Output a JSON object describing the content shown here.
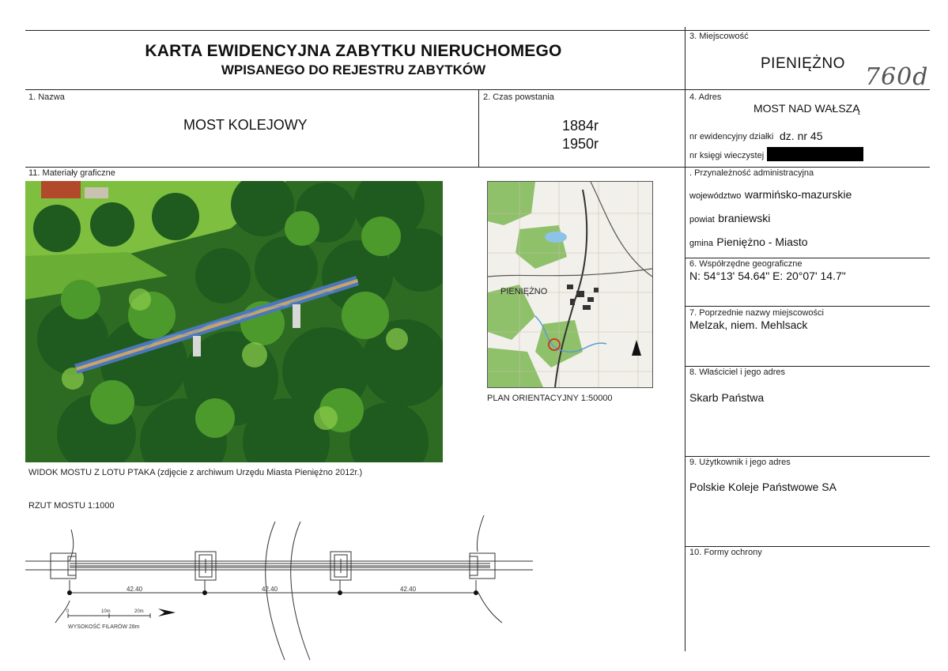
{
  "header": {
    "title_line1": "KARTA EWIDENCYJNA ZABYTKU NIERUCHOMEGO",
    "title_line2": "WPISANEGO DO REJESTRU ZABYTKÓW"
  },
  "miejscowosc": {
    "label": "3. Miejscowość",
    "value": "PIENIĘŻNO",
    "handwritten": "760d"
  },
  "nazwa": {
    "label": "1. Nazwa",
    "value": "MOST KOLEJOWY"
  },
  "czas": {
    "label": "2. Czas powstania",
    "value1": "1884r",
    "value2": "1950r"
  },
  "adres": {
    "label": "4. Adres",
    "value": "MOST NAD WAŁSZĄ",
    "dzialka_label": "nr ewidencyjny działki",
    "dzialka_value": "dz. nr 45",
    "ksiega_label": "nr księgi wieczystej"
  },
  "przynaleznosc": {
    "label": ". Przynależność administracyjna",
    "woj_label": "województwo",
    "woj_value": "warmińsko-mazurskie",
    "powiat_label": "powiat",
    "powiat_value": "braniewski",
    "gmina_label": "gmina",
    "gmina_value": "Pieniężno - Miasto"
  },
  "wspolrzedne": {
    "label": "6. Współrzędne geograficzne",
    "value": "N: 54°13' 54.64\"  E: 20°07' 14.7\""
  },
  "poprzednie": {
    "label": "7. Poprzednie nazwy miejscowości",
    "value": "Melzak, niem. Mehlsack"
  },
  "wlasciciel": {
    "label": "8. Właściciel i jego adres",
    "value": "Skarb Państwa"
  },
  "uzytkownik": {
    "label": "9. Użytkownik i jego adres",
    "value": "Polskie Koleje Państwowe SA"
  },
  "formy": {
    "label": "10. Formy ochrony"
  },
  "materialy": {
    "label": "11. Materiały graficzne",
    "photo_caption": "WIDOK MOSTU Z LOTU PTAKA (zdjęcie z archiwum Urzędu Miasta Pieniężno 2012r.)",
    "map_caption": "PLAN ORIENTACYJNY 1:50000",
    "map_town": "PIENIĘŻNO",
    "plan_caption": "RZUT MOSTU 1:1000"
  },
  "plan": {
    "span1": "42.40",
    "span2": "42.40",
    "span3": "42.40",
    "scale0": "0",
    "scale10": "10m",
    "scale20": "20m",
    "height_note": "WYSOKOŚĆ FILARÓW 28m"
  },
  "colors": {
    "foliage_dark": "#1f5a1f",
    "foliage_light": "#5fa83a",
    "bridge": "#4a78b8",
    "map_red_circle": "#d03020"
  }
}
